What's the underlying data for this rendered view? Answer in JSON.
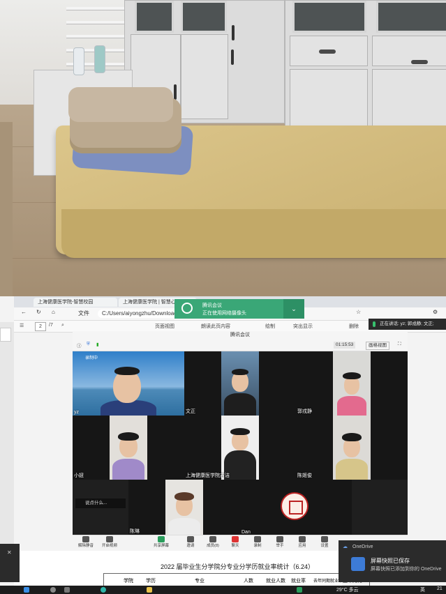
{
  "browser": {
    "tabs": [
      "上海健康医学院-智慧校园",
      "上海健康医学院 | 智慧心"
    ],
    "file_label": "文件",
    "address": "C:/Users/aiyongzhu/Downloads/学S"
  },
  "pdf_toolbar": {
    "page_current": "2",
    "page_total": "/7",
    "items": [
      "页面视图",
      "朗读此页内容",
      "绘制",
      "突出显示",
      "删除"
    ]
  },
  "toast": {
    "title": "腾讯会议",
    "subtitle": "正在使用网络摄像头"
  },
  "speaking_banner": "正在讲话: yz; 郭戎静; 文正;",
  "meeting": {
    "title": "腾讯会议",
    "timer": "01:15:53",
    "view_label": "画格视图",
    "recording_label": "录制中",
    "participants": [
      {
        "name": "yz"
      },
      {
        "name": "文正"
      },
      {
        "name": "郭戎静"
      },
      {
        "name": "小妞"
      },
      {
        "name": "上海健康医学院吉洁"
      },
      {
        "name": "陈姬俊"
      },
      {
        "name": "陈琳"
      },
      {
        "name": "Dan"
      }
    ],
    "chat_popup": "说点什么..."
  },
  "controls": [
    "解除静音",
    "开启视频",
    "共享屏幕",
    "邀请",
    "成员(8)",
    "聊天",
    "录制",
    "举手",
    "应用",
    "设置"
  ],
  "document": {
    "title": "2022 届毕业生分学院分专业分学历就业率统计（6.24）",
    "headers": [
      "学院",
      "学历",
      "专业",
      "人数",
      "就业人数",
      "就业率",
      "去年同期就业率",
      "上年对比"
    ]
  },
  "onedrive": {
    "app": "OneDrive",
    "title": "屏幕快照已保存",
    "body": "屏幕快照已添加到你的 OneDrive"
  },
  "taskbar": {
    "weather": "29°C 多云",
    "lang": "英",
    "time": "21"
  }
}
